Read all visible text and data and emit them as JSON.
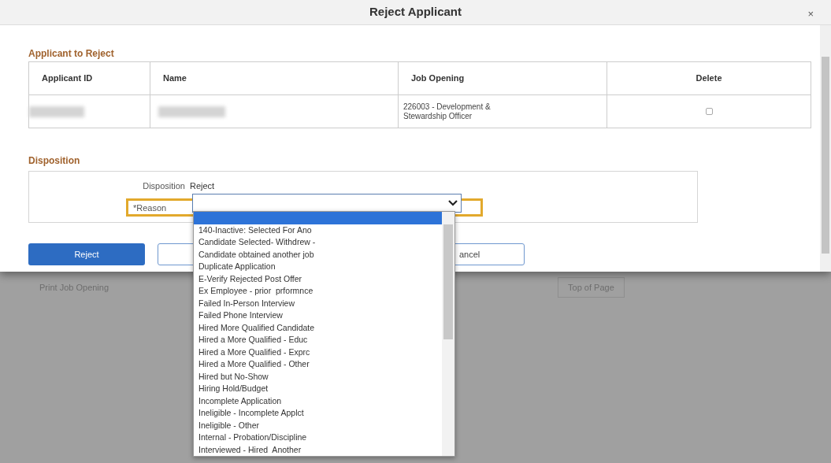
{
  "dialog": {
    "title": "Reject Applicant",
    "close": "×"
  },
  "applicants_section": {
    "title": "Applicant to Reject",
    "columns": [
      "Applicant ID",
      "Name",
      "Job Opening",
      "Delete"
    ],
    "rows": [
      {
        "job_opening": "226003 - Development & Stewardship Officer",
        "delete_checked": false
      }
    ]
  },
  "disposition_section": {
    "title": "Disposition",
    "disposition_label": "Disposition",
    "disposition_value": "Reject",
    "reason_label": "*Reason",
    "reason_highlighted": true
  },
  "buttons": [
    {
      "label": "Reject",
      "kind": "primary"
    },
    {
      "kind": "secondary"
    },
    {
      "label": "ancel",
      "kind": "secondary"
    }
  ],
  "background": {
    "link": "Print Job Opening",
    "top_link": "Top of Page"
  },
  "reason_options": [
    {
      "selected": true
    },
    {
      "label": "140-Inactive: Selected For Ano",
      "selected": false
    },
    {
      "label": "Candidate Selected- Withdrew -",
      "selected": false
    },
    {
      "label": "Candidate obtained another job",
      "selected": false
    },
    {
      "label": "Duplicate Application",
      "selected": false
    },
    {
      "label": "E-Verify Rejected Post Offer",
      "selected": false
    },
    {
      "label": "Ex Employee - prior  prformnce",
      "selected": false
    },
    {
      "label": "Failed In-Person Interview",
      "selected": false
    },
    {
      "label": "Failed Phone Interview",
      "selected": false
    },
    {
      "label": "Hired More Qualified Candidate",
      "selected": false
    },
    {
      "label": "Hired a More Qualified - Educ",
      "selected": false
    },
    {
      "label": "Hired a More Qualified - Exprc",
      "selected": false
    },
    {
      "label": "Hired a More Qualified - Other",
      "selected": false
    },
    {
      "label": "Hired but No-Show",
      "selected": false
    },
    {
      "label": "Hiring Hold/Budget",
      "selected": false
    },
    {
      "label": "Incomplete Application",
      "selected": false
    },
    {
      "label": "Ineligible - Incomplete Applct",
      "selected": false
    },
    {
      "label": "Ineligible - Other",
      "selected": false
    },
    {
      "label": "Internal - Probation/Discipline",
      "selected": false
    },
    {
      "label": "Interviewed - Hired  Another",
      "selected": false
    }
  ]
}
